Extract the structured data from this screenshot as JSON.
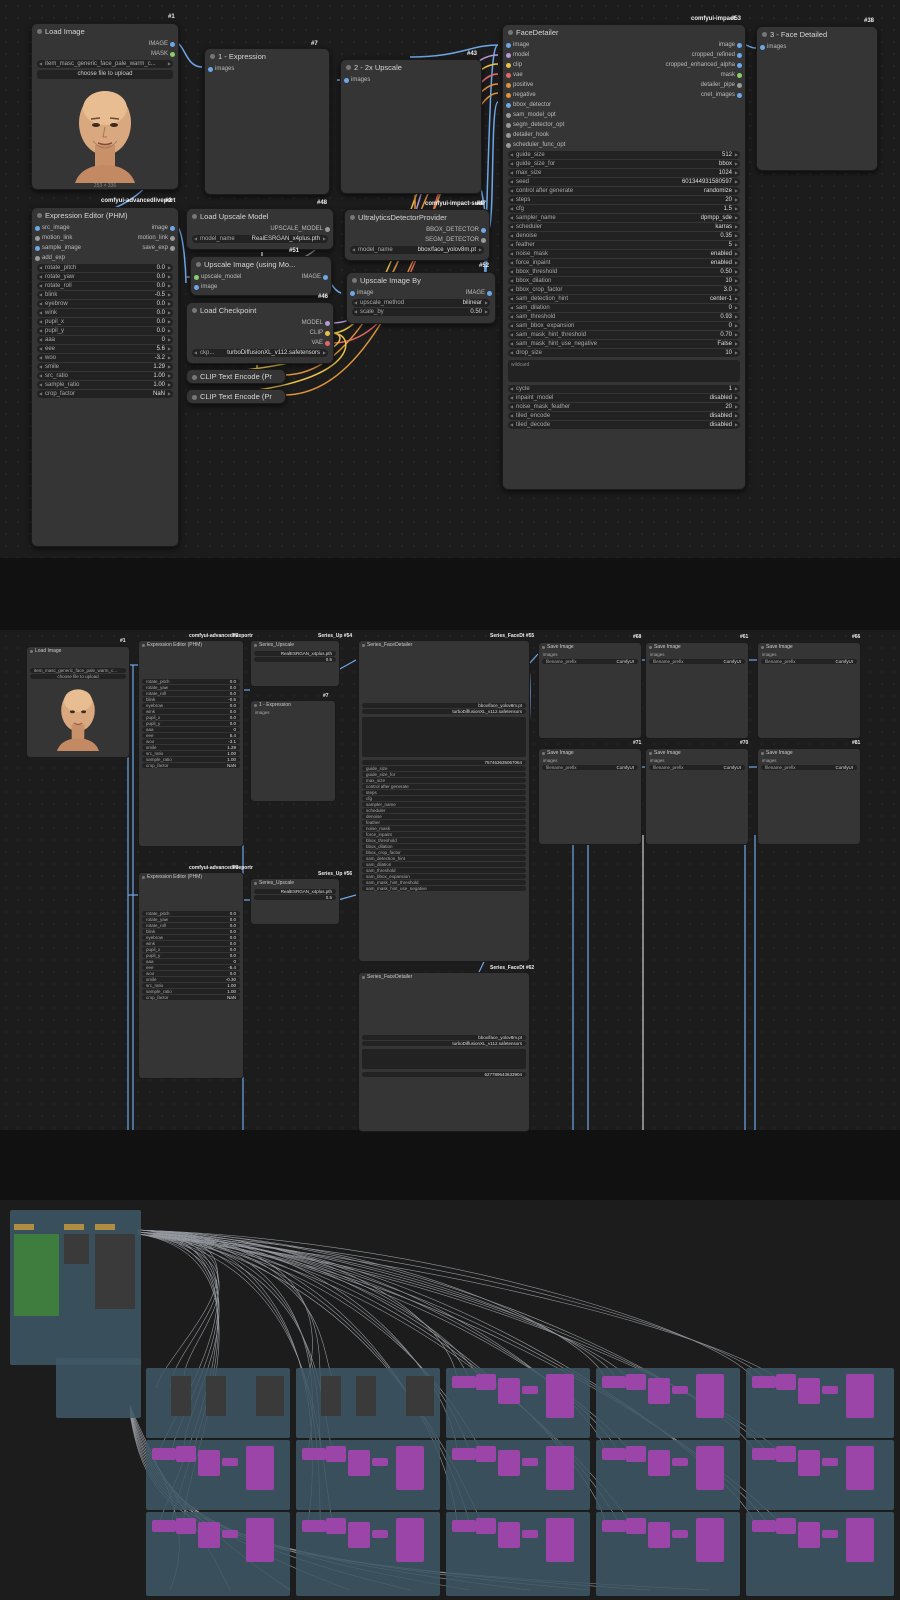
{
  "panel1": {
    "load_image": {
      "title": "Load Image",
      "id": "#1",
      "out_image": "IMAGE",
      "out_mask": "MASK",
      "filename": "item_masc_generic_face_pale_warm_c...",
      "upload": "choose file to upload",
      "dims": "253 × 336"
    },
    "expr1": {
      "title": "1 - Expression",
      "id": "#7",
      "in_images": "images"
    },
    "upscale2x": {
      "title": "2 - 2x Upscale",
      "id": "#43",
      "in_images": "images"
    },
    "facedetailer": {
      "title": "FaceDetailer",
      "pack": "comfyui-impact",
      "id": "#53",
      "inputs": [
        "image",
        "model",
        "clip",
        "vae",
        "positive",
        "negative",
        "bbox_detector",
        "sam_model_opt",
        "segm_detector_opt",
        "detailer_hook",
        "scheduler_func_opt"
      ],
      "outputs": [
        "image",
        "cropped_refined",
        "cropped_enhanced_alpha",
        "mask",
        "detailer_pipe",
        "cnet_images"
      ],
      "widgets": [
        {
          "k": "guide_size",
          "v": "512"
        },
        {
          "k": "guide_size_for",
          "v": "bbox"
        },
        {
          "k": "max_size",
          "v": "1024"
        },
        {
          "k": "seed",
          "v": "601344931580597"
        },
        {
          "k": "control after generate",
          "v": "randomize"
        },
        {
          "k": "steps",
          "v": "20"
        },
        {
          "k": "cfg",
          "v": "1.5"
        },
        {
          "k": "sampler_name",
          "v": "dpmpp_sde"
        },
        {
          "k": "scheduler",
          "v": "karras"
        },
        {
          "k": "denoise",
          "v": "0.35"
        },
        {
          "k": "feather",
          "v": "5"
        },
        {
          "k": "noise_mask",
          "v": "enabled"
        },
        {
          "k": "force_inpaint",
          "v": "enabled"
        },
        {
          "k": "bbox_threshold",
          "v": "0.50"
        },
        {
          "k": "bbox_dilation",
          "v": "10"
        },
        {
          "k": "bbox_crop_factor",
          "v": "3.0"
        },
        {
          "k": "sam_detection_hint",
          "v": "center-1"
        },
        {
          "k": "sam_dilation",
          "v": "0"
        },
        {
          "k": "sam_threshold",
          "v": "0.93"
        },
        {
          "k": "sam_bbox_expansion",
          "v": "0"
        },
        {
          "k": "sam_mask_hint_threshold",
          "v": "0.70"
        },
        {
          "k": "sam_mask_hint_use_negative",
          "v": "False"
        },
        {
          "k": "drop_size",
          "v": "10"
        }
      ],
      "wildcard": "wildcard",
      "widgets2": [
        {
          "k": "cycle",
          "v": "1"
        },
        {
          "k": "inpaint_model",
          "v": "disabled"
        },
        {
          "k": "noise_mask_feather",
          "v": "20"
        },
        {
          "k": "tiled_encode",
          "v": "disabled"
        },
        {
          "k": "tiled_decode",
          "v": "disabled"
        }
      ]
    },
    "face_detailed": {
      "title": "3 - Face Detailed",
      "id": "#38",
      "in_images": "images"
    },
    "expr_editor": {
      "title": "Expression Editor (PHM)",
      "pack": "comfyui-advancedliveport",
      "id": "#2",
      "inputs": [
        "src_image",
        "motion_link",
        "sample_image",
        "add_exp"
      ],
      "outputs": [
        "image",
        "motion_link",
        "save_exp"
      ],
      "widgets": [
        {
          "k": "rotate_pitch",
          "v": "0.0"
        },
        {
          "k": "rotate_yaw",
          "v": "0.0"
        },
        {
          "k": "rotate_roll",
          "v": "0.0"
        },
        {
          "k": "blink",
          "v": "-0.5"
        },
        {
          "k": "eyebrow",
          "v": "0.0"
        },
        {
          "k": "wink",
          "v": "0.0"
        },
        {
          "k": "pupil_x",
          "v": "0.0"
        },
        {
          "k": "pupil_y",
          "v": "0.0"
        },
        {
          "k": "aaa",
          "v": "0"
        },
        {
          "k": "eee",
          "v": "5.6"
        },
        {
          "k": "woo",
          "v": "-3.2"
        },
        {
          "k": "smile",
          "v": "1.29"
        },
        {
          "k": "src_ratio",
          "v": "1.00"
        },
        {
          "k": "sample_ratio",
          "v": "1.00"
        },
        {
          "k": "crop_factor",
          "v": "NaN"
        }
      ]
    },
    "load_upscale": {
      "title": "Load Upscale Model",
      "id": "#48",
      "out": "UPSCALE_MODEL",
      "model_name": "model_name",
      "model_val": "RealESRGAN_x4plus.pth"
    },
    "upscale_using": {
      "title": "Upscale Image (using Mo...",
      "id": "#51",
      "in1": "upscale_model",
      "in2": "image",
      "out": "IMAGE"
    },
    "ultra": {
      "title": "UltralyticsDetectorProvider",
      "pack": "comfyui-impact-subl",
      "id": "#47",
      "out1": "BBOX_DETECTOR",
      "out2": "SEGM_DETECTOR",
      "model_name": "model_name",
      "model_val": "bbox/face_yolov8m.pt"
    },
    "upscale_by": {
      "title": "Upscale Image By",
      "id": "#52",
      "in": "image",
      "out": "IMAGE",
      "w1k": "upscale_method",
      "w1v": "bilinear",
      "w2k": "scale_by",
      "w2v": "0.50"
    },
    "checkpoint": {
      "title": "Load Checkpoint",
      "id": "#46",
      "out1": "MODEL",
      "out2": "CLIP",
      "out3": "VAE",
      "ckpt_k": "ckp...",
      "ckpt_v": "turboDiffusionXL_v112.safetensors"
    },
    "clip1": {
      "title": "CLIP Text Encode (Pr"
    },
    "clip2": {
      "title": "CLIP Text Encode (Pr"
    }
  },
  "panel2": {
    "load_image": {
      "title": "Load Image",
      "id": "#1",
      "filename": "item_masc_generic_face_pale_warm_c...",
      "upload": "choose file to upload"
    },
    "expr_a": {
      "title": "Expression Editor (PHM)",
      "pack": "comfyui-advancedliveportr",
      "id": "#2",
      "rows": [
        {
          "k": "rotate_pitch",
          "v": "0.0"
        },
        {
          "k": "rotate_yaw",
          "v": "0.0"
        },
        {
          "k": "rotate_roll",
          "v": "0.0"
        },
        {
          "k": "blink",
          "v": "-0.5"
        },
        {
          "k": "eyebrow",
          "v": "0.0"
        },
        {
          "k": "wink",
          "v": "0.0"
        },
        {
          "k": "pupil_x",
          "v": "0.0"
        },
        {
          "k": "pupil_y",
          "v": "0.0"
        },
        {
          "k": "aaa",
          "v": "0"
        },
        {
          "k": "eee",
          "v": "5.4"
        },
        {
          "k": "woo",
          "v": "-3.1"
        },
        {
          "k": "smile",
          "v": "1.29"
        },
        {
          "k": "src_ratio",
          "v": "1.00"
        },
        {
          "k": "sample_ratio",
          "v": "1.00"
        },
        {
          "k": "crop_factor",
          "v": "NaN"
        }
      ]
    },
    "expr_b": {
      "title": "Expression Editor (PHM)",
      "pack": "comfyui-advancedliveportr",
      "id": "#3",
      "rows": [
        {
          "k": "rotate_pitch",
          "v": "0.0"
        },
        {
          "k": "rotate_yaw",
          "v": "0.0"
        },
        {
          "k": "rotate_roll",
          "v": "0.0"
        },
        {
          "k": "blink",
          "v": "0.0"
        },
        {
          "k": "eyebrow",
          "v": "0.0"
        },
        {
          "k": "wink",
          "v": "0.0"
        },
        {
          "k": "pupil_x",
          "v": "0.0"
        },
        {
          "k": "pupil_y",
          "v": "0.0"
        },
        {
          "k": "aaa",
          "v": "0"
        },
        {
          "k": "eee",
          "v": "-5.4"
        },
        {
          "k": "woo",
          "v": "0.0"
        },
        {
          "k": "smile",
          "v": "-0.30"
        },
        {
          "k": "src_ratio",
          "v": "1.00"
        },
        {
          "k": "sample_ratio",
          "v": "1.00"
        },
        {
          "k": "crop_factor",
          "v": "NaN"
        }
      ]
    },
    "series_up_a": {
      "title": "Series_Upscale",
      "tag": "Series_Up #54",
      "model": "RealESRGAN_x4plus.pth",
      "scale": "0.5"
    },
    "series_up_b": {
      "title": "Series_Upscale",
      "tag": "Series_Up #56",
      "model": "RealESRGAN_x4plus.pth",
      "scale": "0.5"
    },
    "expr_small": {
      "title": "1 - Expression",
      "id": "#7",
      "in": "images"
    },
    "fd_a": {
      "title": "Series_FaceDetailer",
      "tag": "Series_FaceDt #55",
      "seed": "757463635067064",
      "model": "bbox/face_yolov8m.pt",
      "ckpt": "turboDiffusionXL_v112.safetensors"
    },
    "fd_b": {
      "title": "Series_FaceDetailer",
      "tag": "Series_FaceDt #62",
      "seed": "627789643633904",
      "model": "bbox/face_yolov8m.pt",
      "ckpt": "turboDiffusionXL_v112.safetensors"
    },
    "save": [
      {
        "title": "Save Image",
        "id": "#68",
        "prefix": "ComfyUI"
      },
      {
        "title": "Save Image",
        "id": "#61",
        "prefix": "ComfyUI"
      },
      {
        "title": "Save Image",
        "id": "#66",
        "prefix": "ComfyUI"
      },
      {
        "title": "Save Image",
        "id": "#71",
        "prefix": "ComfyUI"
      },
      {
        "title": "Save Image",
        "id": "#70",
        "prefix": "ComfyUI"
      },
      {
        "title": "Save Image",
        "id": "#81",
        "prefix": "ComfyUI"
      }
    ],
    "prefix_label": "filename_prefix",
    "images_label": "images"
  },
  "colors": {
    "bg": "#1c1c1c",
    "node": "#353535",
    "image_link": "#6ea7e8",
    "clip_link": "#e8c24a",
    "model_link": "#b59ad6",
    "vae_link": "#e86666",
    "group": "#3e5866",
    "save_node": "#9b45a8"
  }
}
